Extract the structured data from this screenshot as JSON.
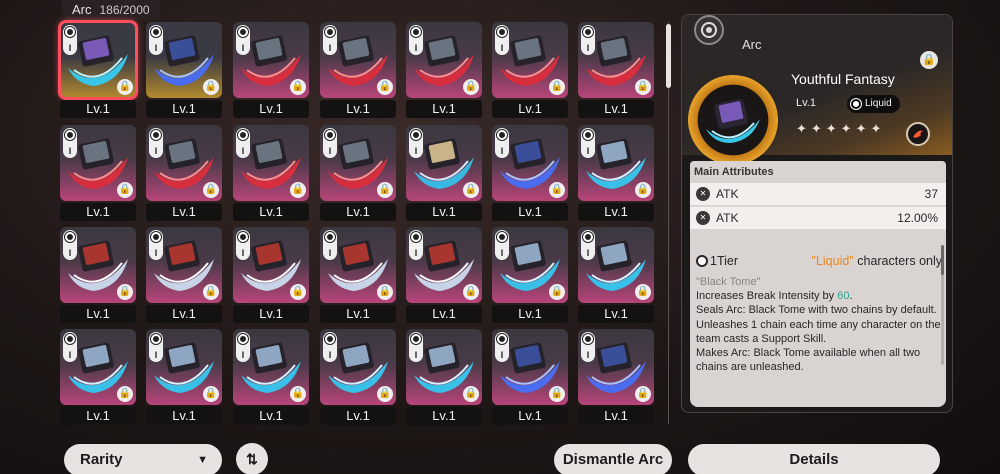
{
  "header": {
    "label": "Arc",
    "count": "186/2000"
  },
  "arcs": [
    {
      "level": "Lv.1",
      "tier": "I",
      "rarity": "gold",
      "art": "black-tome",
      "selected": true
    },
    {
      "level": "Lv.1",
      "tier": "I",
      "rarity": "gold",
      "art": "blue-storm",
      "selected": false
    },
    {
      "level": "Lv.1",
      "tier": "I",
      "rarity": "pink",
      "art": "red-ring",
      "selected": false
    },
    {
      "level": "Lv.1",
      "tier": "I",
      "rarity": "pink",
      "art": "red-ring",
      "selected": false
    },
    {
      "level": "Lv.1",
      "tier": "I",
      "rarity": "pink",
      "art": "red-ring",
      "selected": false
    },
    {
      "level": "Lv.1",
      "tier": "I",
      "rarity": "pink",
      "art": "red-ring",
      "selected": false
    },
    {
      "level": "Lv.1",
      "tier": "I",
      "rarity": "pink",
      "art": "red-ring",
      "selected": false
    },
    {
      "level": "Lv.1",
      "tier": "I",
      "rarity": "pink",
      "art": "red-ring",
      "selected": false
    },
    {
      "level": "Lv.1",
      "tier": "I",
      "rarity": "pink",
      "art": "red-ring",
      "selected": false
    },
    {
      "level": "Lv.1",
      "tier": "I",
      "rarity": "pink",
      "art": "red-ring",
      "selected": false
    },
    {
      "level": "Lv.1",
      "tier": "I",
      "rarity": "pink",
      "art": "red-ring",
      "selected": false
    },
    {
      "level": "Lv.1",
      "tier": "I",
      "rarity": "pink",
      "art": "gold-ice",
      "selected": false
    },
    {
      "level": "Lv.1",
      "tier": "I",
      "rarity": "pink",
      "art": "blue-storm",
      "selected": false
    },
    {
      "level": "Lv.1",
      "tier": "I",
      "rarity": "pink",
      "art": "ice-wave",
      "selected": false
    },
    {
      "level": "Lv.1",
      "tier": "I",
      "rarity": "pink",
      "art": "white-wave",
      "selected": false
    },
    {
      "level": "Lv.1",
      "tier": "I",
      "rarity": "pink",
      "art": "white-wave",
      "selected": false
    },
    {
      "level": "Lv.1",
      "tier": "I",
      "rarity": "pink",
      "art": "white-wave",
      "selected": false
    },
    {
      "level": "Lv.1",
      "tier": "I",
      "rarity": "pink",
      "art": "white-wave",
      "selected": false
    },
    {
      "level": "Lv.1",
      "tier": "I",
      "rarity": "pink",
      "art": "white-wave",
      "selected": false
    },
    {
      "level": "Lv.1",
      "tier": "I",
      "rarity": "pink",
      "art": "ice-wave",
      "selected": false
    },
    {
      "level": "Lv.1",
      "tier": "I",
      "rarity": "pink",
      "art": "ice-wave",
      "selected": false
    },
    {
      "level": "Lv.1",
      "tier": "I",
      "rarity": "pink",
      "art": "ice-wave",
      "selected": false
    },
    {
      "level": "Lv.1",
      "tier": "I",
      "rarity": "pink",
      "art": "ice-wave",
      "selected": false
    },
    {
      "level": "Lv.1",
      "tier": "I",
      "rarity": "pink",
      "art": "ice-wave",
      "selected": false
    },
    {
      "level": "Lv.1",
      "tier": "I",
      "rarity": "pink",
      "art": "ice-wave",
      "selected": false
    },
    {
      "level": "Lv.1",
      "tier": "I",
      "rarity": "pink",
      "art": "ice-wave",
      "selected": false
    },
    {
      "level": "Lv.1",
      "tier": "I",
      "rarity": "pink",
      "art": "blue-storm",
      "selected": false
    },
    {
      "level": "Lv.1",
      "tier": "I",
      "rarity": "pink",
      "art": "blue-storm",
      "selected": false
    }
  ],
  "detail": {
    "category": "Arc",
    "name": "Youthful Fantasy",
    "level": "Lv.1",
    "type": "Liquid",
    "stars": "✦✦✦✦✦✦",
    "main_attributes_title": "Main Attributes",
    "attributes": [
      {
        "name": "ATK",
        "value": "37"
      },
      {
        "name": "ATK",
        "value": "12.00%"
      }
    ],
    "effect": {
      "tier": "1Tier",
      "restriction_type": "\"Liquid\"",
      "restriction_suffix": " characters only",
      "quote": "\"Black Tome\"",
      "line1_prefix": "Increases Break Intensity by ",
      "line1_value": "60",
      "line1_suffix": ".",
      "line2": "Seals Arc: Black Tome with two chains by default. Unleashes 1 chain each time any character on the team casts a Support Skill.",
      "line3": "Makes Arc: Black Tome available when all two chains are unleashed."
    }
  },
  "buttons": {
    "sort": "Rarity",
    "order": "⇅",
    "dismantle": "Dismantle Arc",
    "details": "Details"
  },
  "colors": {
    "selected_outline": "#ff4f5e",
    "rarity_gold": "#b38a2e",
    "rarity_pink": "#b8457a",
    "liquid_accent": "#e9871e",
    "highlight_value": "#2ba58e"
  }
}
